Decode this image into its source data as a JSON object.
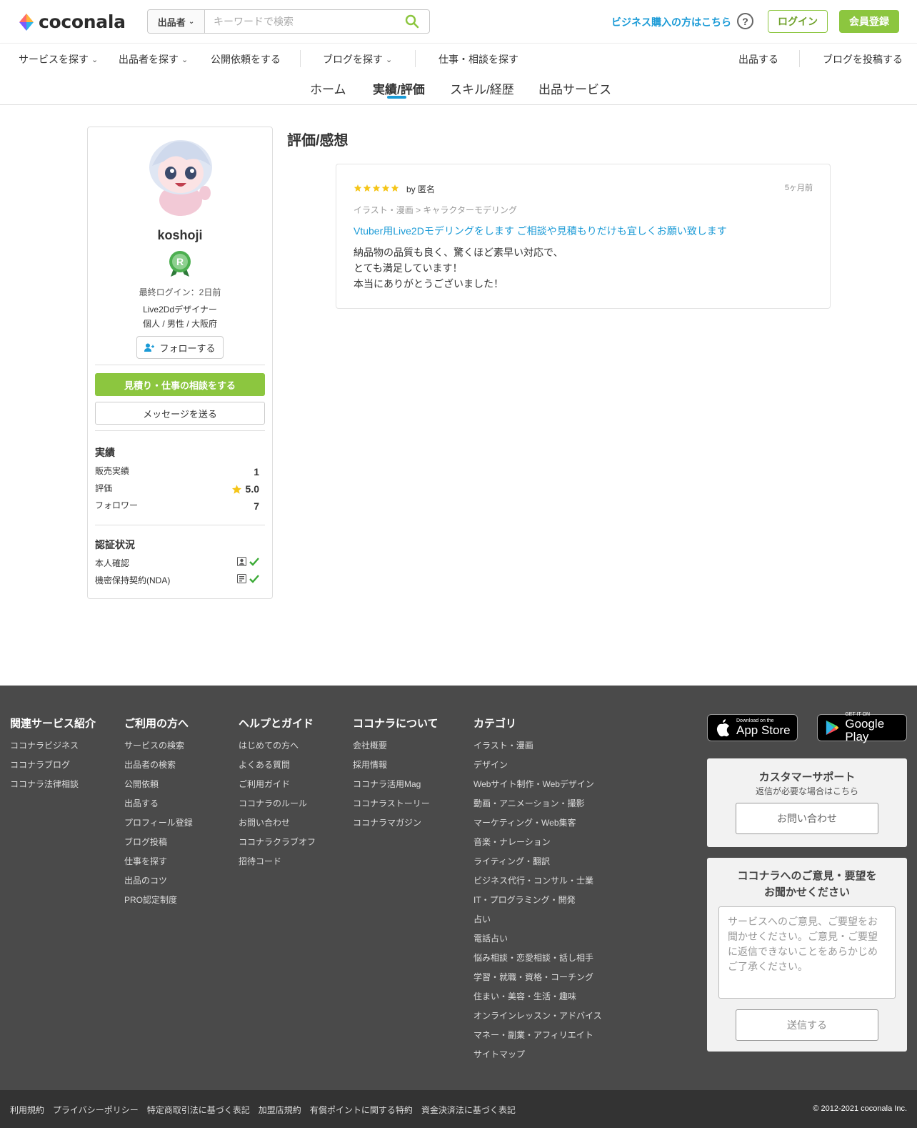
{
  "header": {
    "logo_text": "coconala",
    "search_select": "出品者",
    "search_placeholder": "キーワードで検索",
    "biz_link": "ビジネス購入の方はこちら",
    "help": "?",
    "login": "ログイン",
    "register": "会員登録"
  },
  "nav": {
    "items": [
      "サービスを探す",
      "出品者を探す",
      "公開依頼をする",
      "ブログを探す",
      "仕事・相談を探す",
      "出品する",
      "ブログを投稿する"
    ]
  },
  "tabs": [
    "ホーム",
    "実績/評価",
    "スキル/経歴",
    "出品サービス"
  ],
  "profile": {
    "username": "koshoji",
    "rank": "R",
    "last_login": "最終ログイン：2日前",
    "title": "Live2Ddデザイナー",
    "meta": "個人 / 男性 / 大阪府",
    "follow": "フォローする",
    "quote_button": "見積り・仕事の相談をする",
    "message_button": "メッセージを送る",
    "stats_title": "実績",
    "stats": [
      {
        "label": "販売実績",
        "value": "1"
      },
      {
        "label": "評価",
        "value": "5.0"
      },
      {
        "label": "フォロワー",
        "value": "7"
      }
    ],
    "verify_title": "認証状況",
    "verify": [
      {
        "label": "本人確認"
      },
      {
        "label": "機密保持契約(NDA)"
      }
    ]
  },
  "reviews": {
    "heading": "評価/感想",
    "items": [
      {
        "rating": 5,
        "by": "by 匿名",
        "when": "5ヶ月前",
        "category": "イラスト・漫画 > キャラクターモデリング",
        "service": "Vtuber用Live2Dモデリングをします ご相談や見積もりだけも宜しくお願い致します",
        "body": [
          "納品物の品質も良く、驚くほど素早い対応で、",
          "とても満足しています！",
          "本当にありがとうございました！"
        ]
      }
    ]
  },
  "footer": {
    "cols": [
      {
        "title": "関連サービス紹介",
        "items": [
          "ココナラビジネス",
          "ココナラブログ",
          "ココナラ法律相談"
        ]
      },
      {
        "title": "ご利用の方へ",
        "items": [
          "サービスの検索",
          "出品者の検索",
          "公開依頼",
          "出品する",
          "プロフィール登録",
          "ブログ投稿",
          "仕事を探す",
          "出品のコツ",
          "PRO認定制度"
        ]
      },
      {
        "title": "ヘルプとガイド",
        "items": [
          "はじめての方へ",
          "よくある質問",
          "ご利用ガイド",
          "ココナラのルール",
          "お問い合わせ",
          "ココナラクラブオフ",
          "招待コード"
        ]
      },
      {
        "title": "ココナラについて",
        "items": [
          "会社概要",
          "採用情報",
          "ココナラ活用Mag",
          "ココナラストーリー",
          "ココナラマガジン"
        ]
      },
      {
        "title": "カテゴリ",
        "items": [
          "イラスト・漫画",
          "デザイン",
          "Webサイト制作・Webデザイン",
          "動画・アニメーション・撮影",
          "マーケティング・Web集客",
          "音楽・ナレーション",
          "ライティング・翻訳",
          "ビジネス代行・コンサル・士業",
          "IT・プログラミング・開発",
          "占い",
          "電話占い",
          "悩み相談・恋愛相談・話し相手",
          "学習・就職・資格・コーチング",
          "住まい・美容・生活・趣味",
          "オンラインレッスン・アドバイス",
          "マネー・副業・アフィリエイト",
          "サイトマップ"
        ]
      }
    ],
    "app_store": {
      "small": "Download on the",
      "big": "App Store"
    },
    "google_play": {
      "small": "GET IT ON",
      "big": "Google Play"
    },
    "support": {
      "title": "カスタマーサポート",
      "sub": "返信が必要な場合はこちら",
      "button": "お問い合わせ"
    },
    "feedback": {
      "title_1": "ココナラへのご意見・要望を",
      "title_2": "お聞かせください",
      "placeholder": "サービスへのご意見、ご要望をお聞かせください。ご意見・ご要望に返信できないことをあらかじめご了承ください。",
      "button": "送信する"
    },
    "bottom_links": [
      "利用規約",
      "プライバシーポリシー",
      "特定商取引法に基づく表記",
      "加盟店規約",
      "有償ポイントに関する特約",
      "資金決済法に基づく表記"
    ],
    "copyright": "© 2012-2021 coconala Inc."
  },
  "colors": {
    "accent_green": "#8cc63f",
    "link_blue": "#1a9ad6",
    "star_yellow": "#f5c518",
    "footer_bg": "#4a4a4a"
  }
}
